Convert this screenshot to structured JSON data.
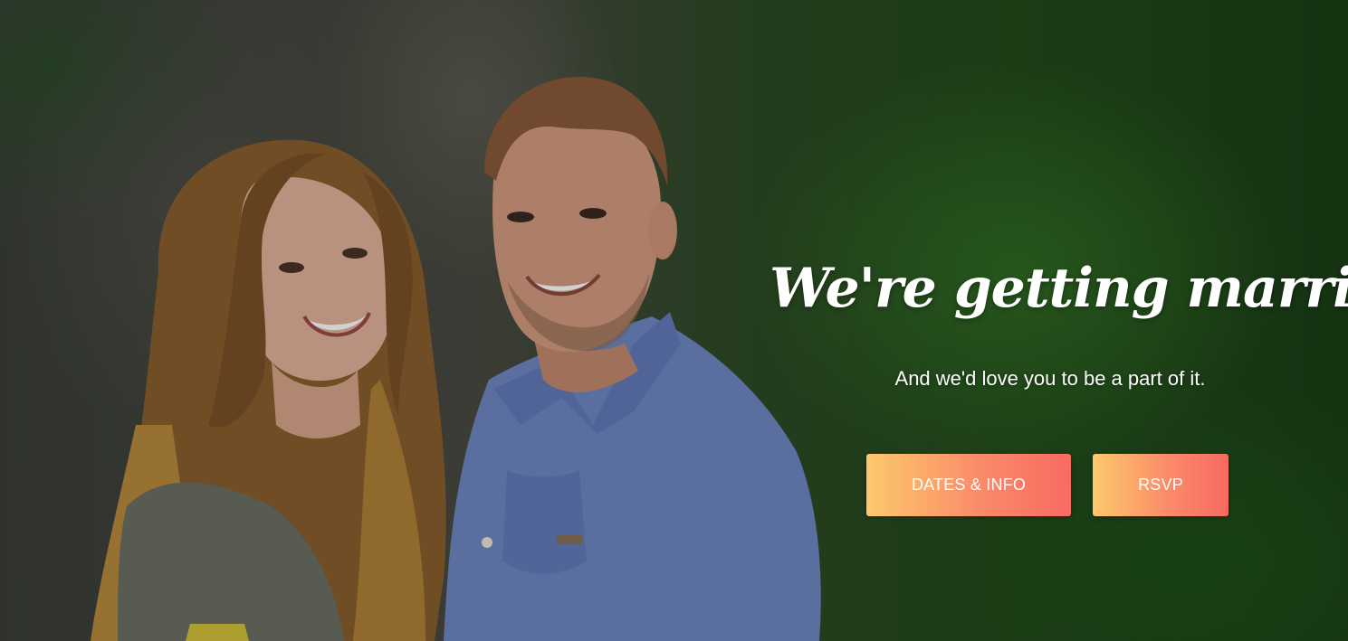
{
  "hero": {
    "headline": "We're getting married!",
    "subhead": "And we'd love you to be a part of it."
  },
  "buttons": {
    "dates_info": "DATES & INFO",
    "rsvp": "RSVP"
  },
  "colors": {
    "button_gradient_start": "#fdc96b",
    "button_gradient_end": "#f86a62",
    "text": "#ffffff"
  }
}
